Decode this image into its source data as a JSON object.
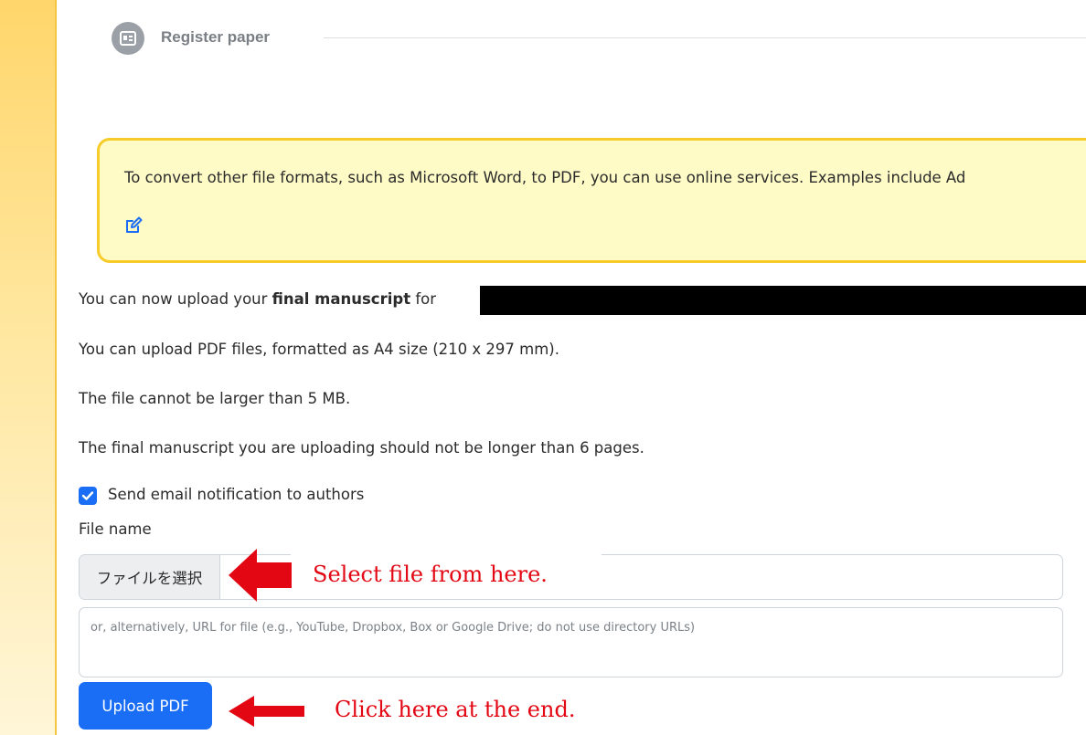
{
  "step": {
    "label": "Register paper",
    "icon": "register-paper-icon"
  },
  "notice": {
    "text": "To convert other file formats, such as Microsoft Word, to PDF, you can use online services. Examples include Ad",
    "icon": "edit-icon"
  },
  "info": {
    "line1_prefix": "You can now upload your ",
    "line1_bold": "final manuscript",
    "line1_suffix": " for",
    "line2": "You can upload PDF files, formatted as A4 size (210 x 297 mm).",
    "line3": "The file cannot be larger than 5 MB.",
    "line4": "The final manuscript you are uploading should not be longer than 6 pages."
  },
  "form": {
    "notify_label": "Send email notification to authors",
    "notify_checked": true,
    "file_label": "File name",
    "file_button": "ファイルを選択",
    "url_placeholder": "or, alternatively, URL for file (e.g., YouTube, Dropbox, Box or Google Drive; do not use directory URLs)",
    "upload_button": "Upload PDF"
  },
  "annotations": {
    "select_file": "Select file from here.",
    "click_end": "Click here at the end.",
    "color": "#e30613"
  },
  "colors": {
    "primary": "#1a6ef5",
    "notice_bg": "#fffbc7",
    "notice_border": "#f7cc2a"
  }
}
